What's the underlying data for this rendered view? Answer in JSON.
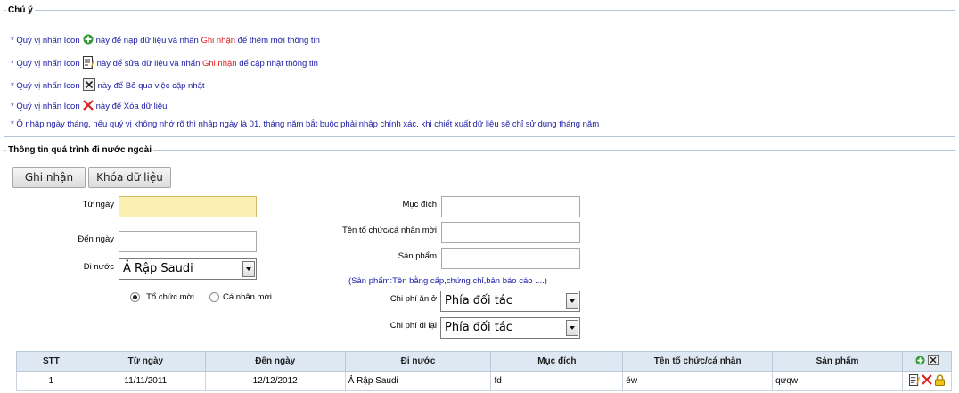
{
  "notes": {
    "legend": "Chú ý",
    "line1": {
      "a": "* Quý vị nhấn Icon",
      "b": "này để nạp dữ liệu và nhấn",
      "highlight": "Ghi nhận",
      "c": "để thêm mới thông tin"
    },
    "line2": {
      "a": "* Quý vị nhấn Icon",
      "b": "này để sửa dữ liệu và nhấn",
      "highlight": "Ghi nhận",
      "c": "để cập nhật thông tin"
    },
    "line3": {
      "a": "* Quý vị nhấn Icon",
      "b": "này để Bỏ qua việc cập nhật"
    },
    "line4": {
      "a": "* Quý vị nhấn Icon",
      "b": "này để Xóa dữ liệu"
    },
    "line5": "* Ô nhập ngày tháng, nếu quý vị không nhớ rõ thì nhập ngày là 01, tháng năm bắt buộc phải nhập chính xác. khi chiết xuất dữ liệu sẽ chỉ sử dụng tháng năm"
  },
  "section": {
    "legend": "Thông tin quá trình đi nước ngoài"
  },
  "toolbar": {
    "save": "Ghi nhận",
    "lock": "Khóa dữ liệu"
  },
  "form": {
    "from_date_label": "Từ ngày",
    "from_date_value": "",
    "to_date_label": "Đến ngày",
    "to_date_value": "",
    "country_label": "Đi nước",
    "country_value": "Ả Rập Saudi",
    "radio_org": "Tổ chức mời",
    "radio_person": "Cá nhân mời",
    "purpose_label": "Mục đích",
    "purpose_value": "",
    "inviter_label": "Tên tổ chức/cá nhân mời",
    "inviter_value": "",
    "product_label": "Sản phẩm",
    "product_value": "",
    "product_hint": "(Sản phẩm:Tên bằng cấp,chứng chỉ,bản báo cáo ....)",
    "lodging_label": "Chi phí ăn ở",
    "lodging_value": "Phía đối tác",
    "travel_label": "Chi phí đi lại",
    "travel_value": "Phía đối tác"
  },
  "table": {
    "headers": [
      "STT",
      "Từ ngày",
      "Đến ngày",
      "Đi nước",
      "Mục đích",
      "Tên tổ chức/cá nhân",
      "Sản phẩm"
    ],
    "rows": [
      {
        "stt": "1",
        "from": "11/11/2011",
        "to": "12/12/2012",
        "country": "Ả Rập Saudi",
        "purpose": "fd",
        "org": "éw",
        "product": "qưqw"
      }
    ]
  },
  "icons": {
    "add": "add-plus-icon",
    "edit": "edit-icon",
    "cancel": "cancel-icon",
    "delete": "delete-x-icon",
    "lock": "lock-icon"
  },
  "colors": {
    "note_text": "#1a1aa6",
    "highlight": "#e02020",
    "header_bg": "#dde8f3",
    "focus_bg": "#fbefb2"
  }
}
